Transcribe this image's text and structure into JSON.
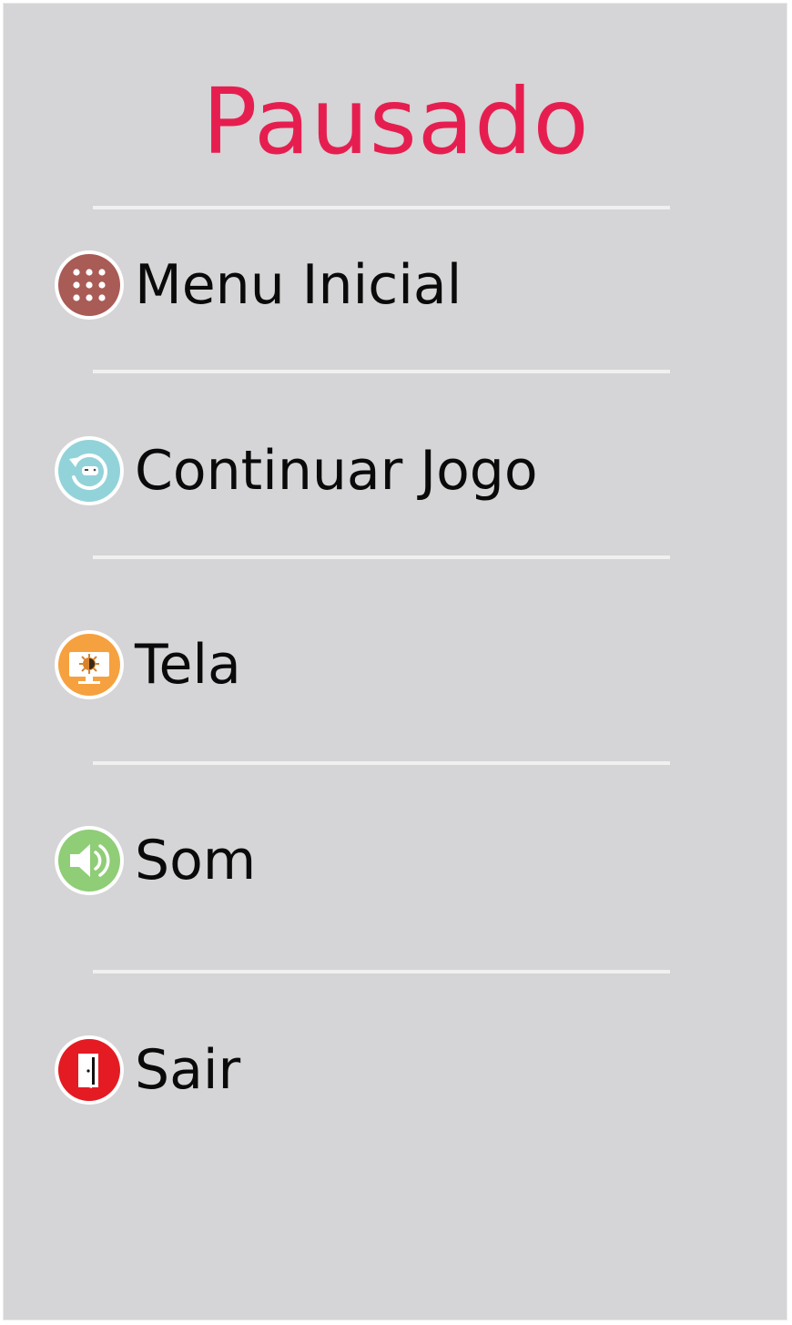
{
  "title": "Pausado",
  "menu": [
    {
      "label": "Menu Inicial",
      "icon": "grid-dots-icon",
      "color": "#a95b55"
    },
    {
      "label": "Continuar Jogo",
      "icon": "resume-game-icon",
      "color": "#92d3da"
    },
    {
      "label": "Tela",
      "icon": "monitor-brightness-icon",
      "color": "#f6a13f"
    },
    {
      "label": "Som",
      "icon": "speaker-icon",
      "color": "#8fcd77"
    },
    {
      "label": "Sair",
      "icon": "exit-door-icon",
      "color": "#e41b23"
    }
  ],
  "colors": {
    "background": "#d5d4d6",
    "title": "#e61e50",
    "divider": "#f0f0f1"
  }
}
